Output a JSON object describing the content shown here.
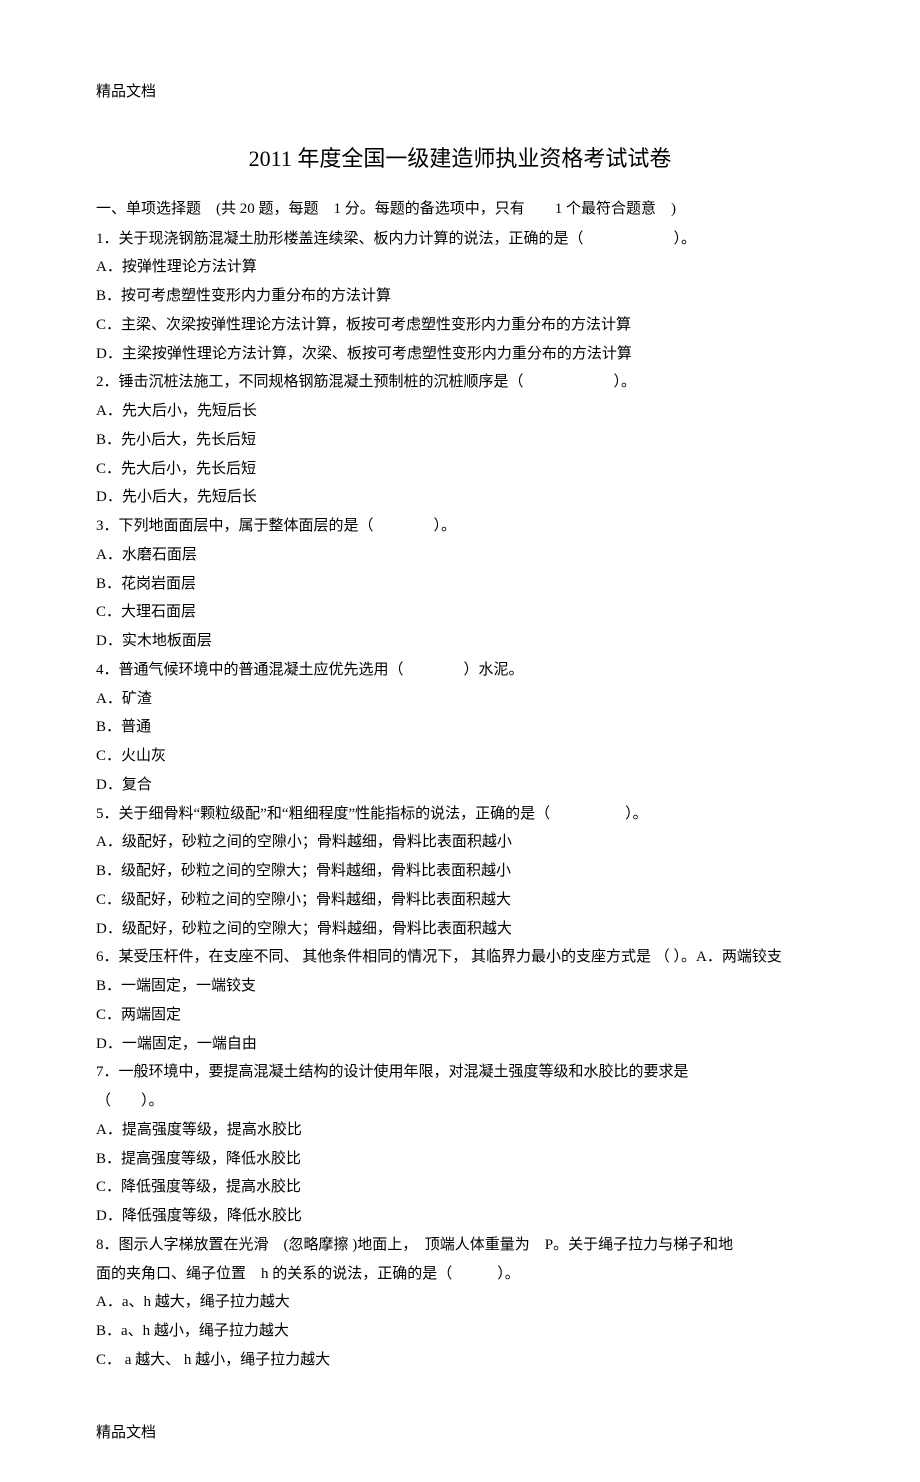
{
  "header": "精品文档",
  "footer": "精品文档",
  "title": "2011 年度全国一级建造师执业资格考试试卷",
  "section1": "一、单项选择题　(共 20 题，每题　1 分。每题的备选项中，只有　　1 个最符合题意　)",
  "q1": {
    "stem": "1．关于现浇钢筋混凝土肋形楼盖连续梁、板内力计算的说法，正确的是（　　　　　　）。",
    "A": "A．按弹性理论方法计算",
    "B": "B．按可考虑塑性变形内力重分布的方法计算",
    "C": "C．主梁、次梁按弹性理论方法计算，板按可考虑塑性变形内力重分布的方法计算",
    "D": "D．主梁按弹性理论方法计算，次梁、板按可考虑塑性变形内力重分布的方法计算"
  },
  "q2": {
    "stem": "2．锤击沉桩法施工，不同规格钢筋混凝土预制桩的沉桩顺序是（　　　　　　）。",
    "A": "A．先大后小，先短后长",
    "B": "B．先小后大，先长后短",
    "C": "C．先大后小，先长后短",
    "D": "D．先小后大，先短后长"
  },
  "q3": {
    "stem": "3．下列地面面层中，属于整体面层的是（　　　　）。",
    "A": "A．水磨石面层",
    "B": "B．花岗岩面层",
    "C": "C．大理石面层",
    "D": "D．实木地板面层"
  },
  "q4": {
    "stem": "4．普通气候环境中的普通混凝土应优先选用（　　　　）水泥。",
    "A": "A．矿渣",
    "B": "B．普通",
    "C": "C．火山灰",
    "D": "D．复合"
  },
  "q5": {
    "stem": "5．关于细骨料“颗粒级配”和“粗细程度”性能指标的说法，正确的是（　　　　　）。",
    "A": "A．级配好，砂粒之间的空隙小；骨料越细，骨料比表面积越小",
    "B": "B．级配好，砂粒之间的空隙大；骨料越细，骨料比表面积越小",
    "C": "C．级配好，砂粒之间的空隙小；骨料越细，骨料比表面积越大",
    "D": "D．级配好，砂粒之间的空隙大；骨料越细，骨料比表面积越大"
  },
  "q6": {
    "stem": "6．某受压杆件，在支座不同、 其他条件相同的情况下， 其临界力最小的支座方式是 （ ）。A．两端铰支",
    "B": "B．一端固定，一端铰支",
    "C": "C．两端固定",
    "D": "D．一端固定，一端自由"
  },
  "q7": {
    "stem1": "7．一般环境中，要提高混凝土结构的设计使用年限，对混凝土强度等级和水胶比的要求是",
    "stem2": "（　　）。",
    "A": "A．提高强度等级，提高水胶比",
    "B": "B．提高强度等级，降低水胶比",
    "C": "C．降低强度等级，提高水胶比",
    "D": "D．降低强度等级，降低水胶比"
  },
  "q8": {
    "stem1": "8．图示人字梯放置在光滑　(忽略摩擦 )地面上，　顶端人体重量为　P。关于绳子拉力与梯子和地",
    "stem2": "面的夹角口、绳子位置　h 的关系的说法，正确的是（　　　）。",
    "A": "A．a、h 越大，绳子拉力越大",
    "B": "B．a、h 越小，绳子拉力越大",
    "C": "C． a 越大、 h 越小，绳子拉力越大"
  }
}
